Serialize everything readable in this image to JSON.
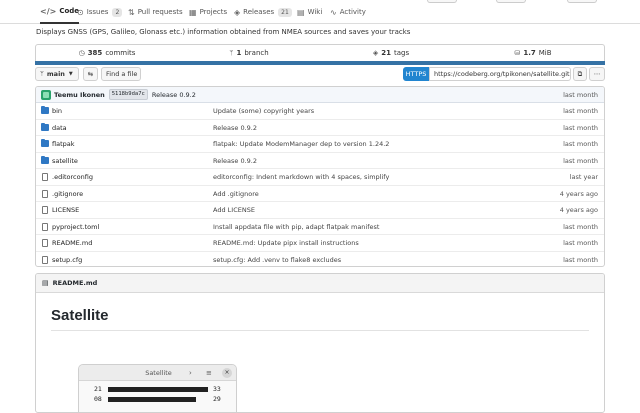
{
  "tabs": [
    {
      "label": "Code",
      "icon": "code-icon",
      "active": true
    },
    {
      "label": "Issues",
      "icon": "issue-icon",
      "count": "2"
    },
    {
      "label": "Pull requests",
      "icon": "pull-request-icon"
    },
    {
      "label": "Projects",
      "icon": "project-icon"
    },
    {
      "label": "Releases",
      "icon": "tag-icon",
      "count": "21"
    },
    {
      "label": "Wiki",
      "icon": "book-icon"
    },
    {
      "label": "Activity",
      "icon": "pulse-icon"
    }
  ],
  "description": "Displays GNSS (GPS, Galileo, Glonass etc.) information obtained from NMEA sources and saves your tracks",
  "stats": {
    "commits_count": "385",
    "commits_label": "commits",
    "branches_count": "1",
    "branches_label": "branch",
    "tags_count": "21",
    "tags_label": "tags",
    "size": "1.7",
    "size_unit": "MiB"
  },
  "language_color": "#3572A5",
  "toolbar": {
    "branch": "main",
    "find_file": "Find a file",
    "protocol": "HTTPS",
    "clone_url": "https://codeberg.org/tpikonen/satellite.git"
  },
  "last_commit": {
    "author": "Teemu Ikonen",
    "sha": "5118b9da7c",
    "message": "Release 0.9.2",
    "time": "last month"
  },
  "files": [
    {
      "name": "bin",
      "type": "folder",
      "message": "Update (some) copyright years",
      "time": "last month"
    },
    {
      "name": "data",
      "type": "folder",
      "message": "Release 0.9.2",
      "time": "last month"
    },
    {
      "name": "flatpak",
      "type": "folder",
      "message": "flatpak: Update ModemManager dep to version 1.24.2",
      "time": "last month"
    },
    {
      "name": "satellite",
      "type": "folder",
      "message": "Release 0.9.2",
      "time": "last month"
    },
    {
      "name": ".editorconfig",
      "type": "file",
      "message": "editorconfig: Indent markdown with 4 spaces, simplify",
      "time": "last year"
    },
    {
      "name": ".gitignore",
      "type": "file",
      "message": "Add .gitignore",
      "time": "4 years ago"
    },
    {
      "name": "LICENSE",
      "type": "file",
      "message": "Add LICENSE",
      "time": "4 years ago"
    },
    {
      "name": "pyproject.toml",
      "type": "file",
      "message": "Install appdata file with pip, adapt flatpak manifest",
      "time": "last month"
    },
    {
      "name": "README.md",
      "type": "file",
      "message": "README.md: Update pipx install instructions",
      "time": "last month"
    },
    {
      "name": "setup.cfg",
      "type": "file",
      "message": "setup.cfg: Add .venv to flake8 excludes",
      "time": "last month"
    }
  ],
  "readme": {
    "filename": "README.md",
    "heading": "Satellite",
    "window_title": "Satellite",
    "satellites": [
      {
        "prn": "21",
        "snr": "33",
        "level": 33
      },
      {
        "prn": "08",
        "snr": "29",
        "level": 29
      }
    ]
  }
}
